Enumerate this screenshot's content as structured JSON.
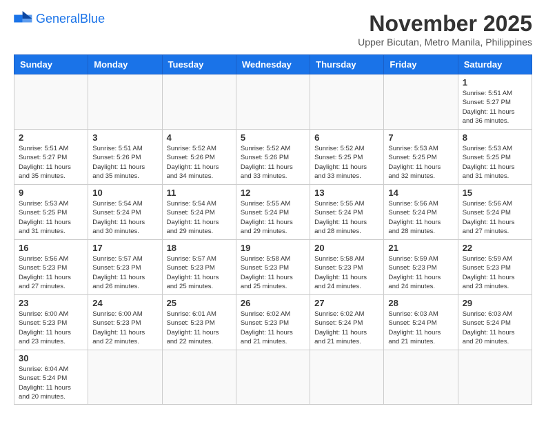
{
  "header": {
    "logo_general": "General",
    "logo_blue": "Blue",
    "month": "November 2025",
    "location": "Upper Bicutan, Metro Manila, Philippines"
  },
  "weekdays": [
    "Sunday",
    "Monday",
    "Tuesday",
    "Wednesday",
    "Thursday",
    "Friday",
    "Saturday"
  ],
  "weeks": [
    [
      {
        "day": "",
        "info": ""
      },
      {
        "day": "",
        "info": ""
      },
      {
        "day": "",
        "info": ""
      },
      {
        "day": "",
        "info": ""
      },
      {
        "day": "",
        "info": ""
      },
      {
        "day": "",
        "info": ""
      },
      {
        "day": "1",
        "info": "Sunrise: 5:51 AM\nSunset: 5:27 PM\nDaylight: 11 hours\nand 36 minutes."
      }
    ],
    [
      {
        "day": "2",
        "info": "Sunrise: 5:51 AM\nSunset: 5:27 PM\nDaylight: 11 hours\nand 35 minutes."
      },
      {
        "day": "3",
        "info": "Sunrise: 5:51 AM\nSunset: 5:26 PM\nDaylight: 11 hours\nand 35 minutes."
      },
      {
        "day": "4",
        "info": "Sunrise: 5:52 AM\nSunset: 5:26 PM\nDaylight: 11 hours\nand 34 minutes."
      },
      {
        "day": "5",
        "info": "Sunrise: 5:52 AM\nSunset: 5:26 PM\nDaylight: 11 hours\nand 33 minutes."
      },
      {
        "day": "6",
        "info": "Sunrise: 5:52 AM\nSunset: 5:25 PM\nDaylight: 11 hours\nand 33 minutes."
      },
      {
        "day": "7",
        "info": "Sunrise: 5:53 AM\nSunset: 5:25 PM\nDaylight: 11 hours\nand 32 minutes."
      },
      {
        "day": "8",
        "info": "Sunrise: 5:53 AM\nSunset: 5:25 PM\nDaylight: 11 hours\nand 31 minutes."
      }
    ],
    [
      {
        "day": "9",
        "info": "Sunrise: 5:53 AM\nSunset: 5:25 PM\nDaylight: 11 hours\nand 31 minutes."
      },
      {
        "day": "10",
        "info": "Sunrise: 5:54 AM\nSunset: 5:24 PM\nDaylight: 11 hours\nand 30 minutes."
      },
      {
        "day": "11",
        "info": "Sunrise: 5:54 AM\nSunset: 5:24 PM\nDaylight: 11 hours\nand 29 minutes."
      },
      {
        "day": "12",
        "info": "Sunrise: 5:55 AM\nSunset: 5:24 PM\nDaylight: 11 hours\nand 29 minutes."
      },
      {
        "day": "13",
        "info": "Sunrise: 5:55 AM\nSunset: 5:24 PM\nDaylight: 11 hours\nand 28 minutes."
      },
      {
        "day": "14",
        "info": "Sunrise: 5:56 AM\nSunset: 5:24 PM\nDaylight: 11 hours\nand 28 minutes."
      },
      {
        "day": "15",
        "info": "Sunrise: 5:56 AM\nSunset: 5:24 PM\nDaylight: 11 hours\nand 27 minutes."
      }
    ],
    [
      {
        "day": "16",
        "info": "Sunrise: 5:56 AM\nSunset: 5:23 PM\nDaylight: 11 hours\nand 27 minutes."
      },
      {
        "day": "17",
        "info": "Sunrise: 5:57 AM\nSunset: 5:23 PM\nDaylight: 11 hours\nand 26 minutes."
      },
      {
        "day": "18",
        "info": "Sunrise: 5:57 AM\nSunset: 5:23 PM\nDaylight: 11 hours\nand 25 minutes."
      },
      {
        "day": "19",
        "info": "Sunrise: 5:58 AM\nSunset: 5:23 PM\nDaylight: 11 hours\nand 25 minutes."
      },
      {
        "day": "20",
        "info": "Sunrise: 5:58 AM\nSunset: 5:23 PM\nDaylight: 11 hours\nand 24 minutes."
      },
      {
        "day": "21",
        "info": "Sunrise: 5:59 AM\nSunset: 5:23 PM\nDaylight: 11 hours\nand 24 minutes."
      },
      {
        "day": "22",
        "info": "Sunrise: 5:59 AM\nSunset: 5:23 PM\nDaylight: 11 hours\nand 23 minutes."
      }
    ],
    [
      {
        "day": "23",
        "info": "Sunrise: 6:00 AM\nSunset: 5:23 PM\nDaylight: 11 hours\nand 23 minutes."
      },
      {
        "day": "24",
        "info": "Sunrise: 6:00 AM\nSunset: 5:23 PM\nDaylight: 11 hours\nand 22 minutes."
      },
      {
        "day": "25",
        "info": "Sunrise: 6:01 AM\nSunset: 5:23 PM\nDaylight: 11 hours\nand 22 minutes."
      },
      {
        "day": "26",
        "info": "Sunrise: 6:02 AM\nSunset: 5:23 PM\nDaylight: 11 hours\nand 21 minutes."
      },
      {
        "day": "27",
        "info": "Sunrise: 6:02 AM\nSunset: 5:24 PM\nDaylight: 11 hours\nand 21 minutes."
      },
      {
        "day": "28",
        "info": "Sunrise: 6:03 AM\nSunset: 5:24 PM\nDaylight: 11 hours\nand 21 minutes."
      },
      {
        "day": "29",
        "info": "Sunrise: 6:03 AM\nSunset: 5:24 PM\nDaylight: 11 hours\nand 20 minutes."
      }
    ],
    [
      {
        "day": "30",
        "info": "Sunrise: 6:04 AM\nSunset: 5:24 PM\nDaylight: 11 hours\nand 20 minutes."
      },
      {
        "day": "",
        "info": ""
      },
      {
        "day": "",
        "info": ""
      },
      {
        "day": "",
        "info": ""
      },
      {
        "day": "",
        "info": ""
      },
      {
        "day": "",
        "info": ""
      },
      {
        "day": "",
        "info": ""
      }
    ]
  ]
}
